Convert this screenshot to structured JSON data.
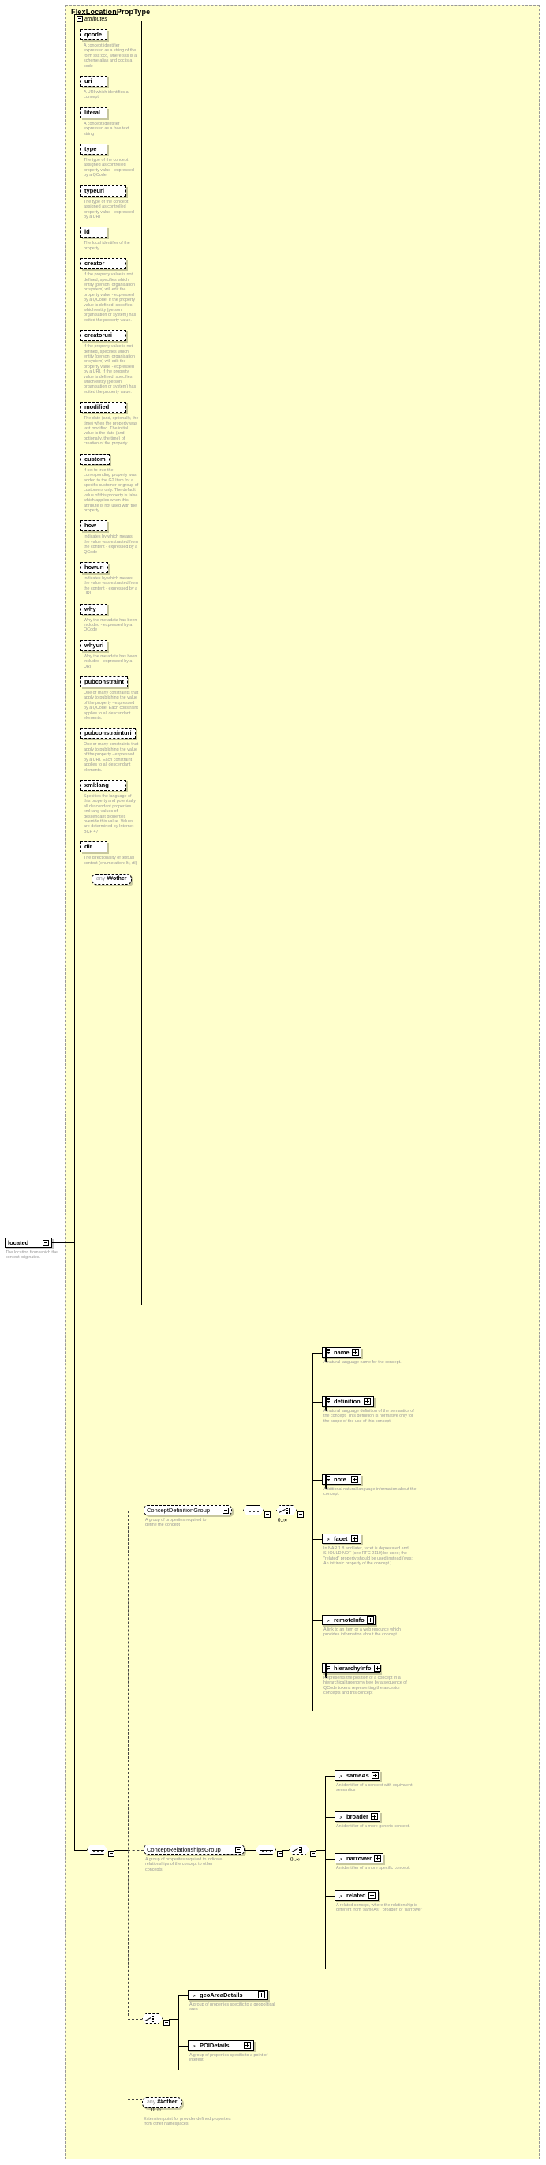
{
  "diagram": {
    "type_name": "FlexLocationPropType",
    "attributes_label": "attributes"
  },
  "attributes": [
    {
      "name": "qcode",
      "desc": "A concept identifier expressed as a string of the form sss:ccc, where sss is a scheme alias and ccc is a code"
    },
    {
      "name": "uri",
      "desc": "A URI which identifies a concept."
    },
    {
      "name": "literal",
      "desc": "A concept identifier expressed as a free text string"
    },
    {
      "name": "type",
      "desc": "The type of the concept assigned as controlled property value - expressed by a QCode"
    },
    {
      "name": "typeuri",
      "desc": "The type of the concept assigned as controlled property value - expressed by a URI"
    },
    {
      "name": "id",
      "desc": "The local identifier of the property."
    },
    {
      "name": "creator",
      "desc": "If the property value is not defined, specifies which entity (person, organisation or system) will edit the property value - expressed by a QCode. If the property value is defined, specifies which entity (person, organisation or system) has edited the property value."
    },
    {
      "name": "creatoruri",
      "desc": "If the property value is not defined, specifies which entity (person, organisation or system) will edit the property value - expressed by a URI. If the property value is defined, specifies which entity (person, organisation or system) has edited the property value."
    },
    {
      "name": "modified",
      "desc": "The date (and, optionally, the time) when the property was last modified. The initial value is the date (and, optionally, the time) of creation of the property."
    },
    {
      "name": "custom",
      "desc": "If set to true the corresponding property was added to the G2 Item for a specific customer or group of customers only. The default value of this property is false which applies when this attribute is not used with the property."
    },
    {
      "name": "how",
      "desc": "Indicates by which means the value was extracted from the content - expressed by a QCode"
    },
    {
      "name": "howuri",
      "desc": "Indicates by which means the value was extracted from the content - expressed by a URI"
    },
    {
      "name": "why",
      "desc": "Why the metadata has been included - expressed by a QCode"
    },
    {
      "name": "whyuri",
      "desc": "Why the metadata has been included - expressed by a URI"
    },
    {
      "name": "pubconstraint",
      "desc": "One or many constraints that apply to publishing the value of the property - expressed by a QCode. Each constraint applies to all descendant elements."
    },
    {
      "name": "pubconstrainturi",
      "desc": "One or many constraints that apply to publishing the value of the property - expressed by a URI. Each constraint applies to all descendant elements."
    },
    {
      "name": "xml:lang",
      "desc": "Specifies the language of this property and potentially all descendant properties. xml:lang values of descendant properties override this value. Values are determined by Internet BCP 47."
    },
    {
      "name": "dir",
      "desc": "The directionality of textual content (enumeration: ltr, rtl)"
    }
  ],
  "attributes_any": {
    "label_any": "any",
    "label_ns": "##other"
  },
  "root_element": {
    "name": "located",
    "desc": "The location from which the content originates."
  },
  "groups": [
    {
      "name": "ConceptDefinitionGroup",
      "desc": "A group of properites required to define the concept",
      "occurs": "0..∞",
      "children": [
        {
          "name": "name",
          "desc": "A natural language name for the concept."
        },
        {
          "name": "definition",
          "desc": "A natural language definition of the semantics of the concept. This definition is normative only for the scope of the use of this concept."
        },
        {
          "name": "note",
          "desc": "Additional natural language information about the concept."
        },
        {
          "name": "facet",
          "desc": "In NAR 1.8 and later, facet is deprecated and SHOULD NOT (see RFC 2119) be used; the \"related\" property should be used instead (was: An intrinsic property of the concept.)"
        },
        {
          "name": "remoteInfo",
          "desc": "A link to an item or a web resource which provides information about the concept"
        },
        {
          "name": "hierarchyInfo",
          "desc": "Represents the position of a concept in a hierarchical taxonomy tree by a sequence of QCode tokens representing the ancestor concepts and this concept"
        }
      ]
    },
    {
      "name": "ConceptRelationshipsGroup",
      "desc": "A group of properites required to indicate relationships of the concept to other concepts",
      "occurs": "0..∞",
      "children": [
        {
          "name": "sameAs",
          "desc": "An identifier of a concept with equivalent semantics"
        },
        {
          "name": "broader",
          "desc": "An identifier of a more generic concept."
        },
        {
          "name": "narrower",
          "desc": "An identifier of a more specific concept."
        },
        {
          "name": "related",
          "desc": "A related concept, where the relationship is different from 'sameAs', 'broader' or 'narrower'"
        }
      ]
    }
  ],
  "details_choice": {
    "children": [
      {
        "name": "geoAreaDetails",
        "desc": "A group of properties specific to a geopolitical area"
      },
      {
        "name": "POIDetails",
        "desc": "A group of properties specific to a point of interest"
      }
    ]
  },
  "content_any": {
    "label_any": "any",
    "label_ns": "##other",
    "occurs": "0..∞",
    "desc": "Extension point for provider-defined properties from other namespaces"
  }
}
